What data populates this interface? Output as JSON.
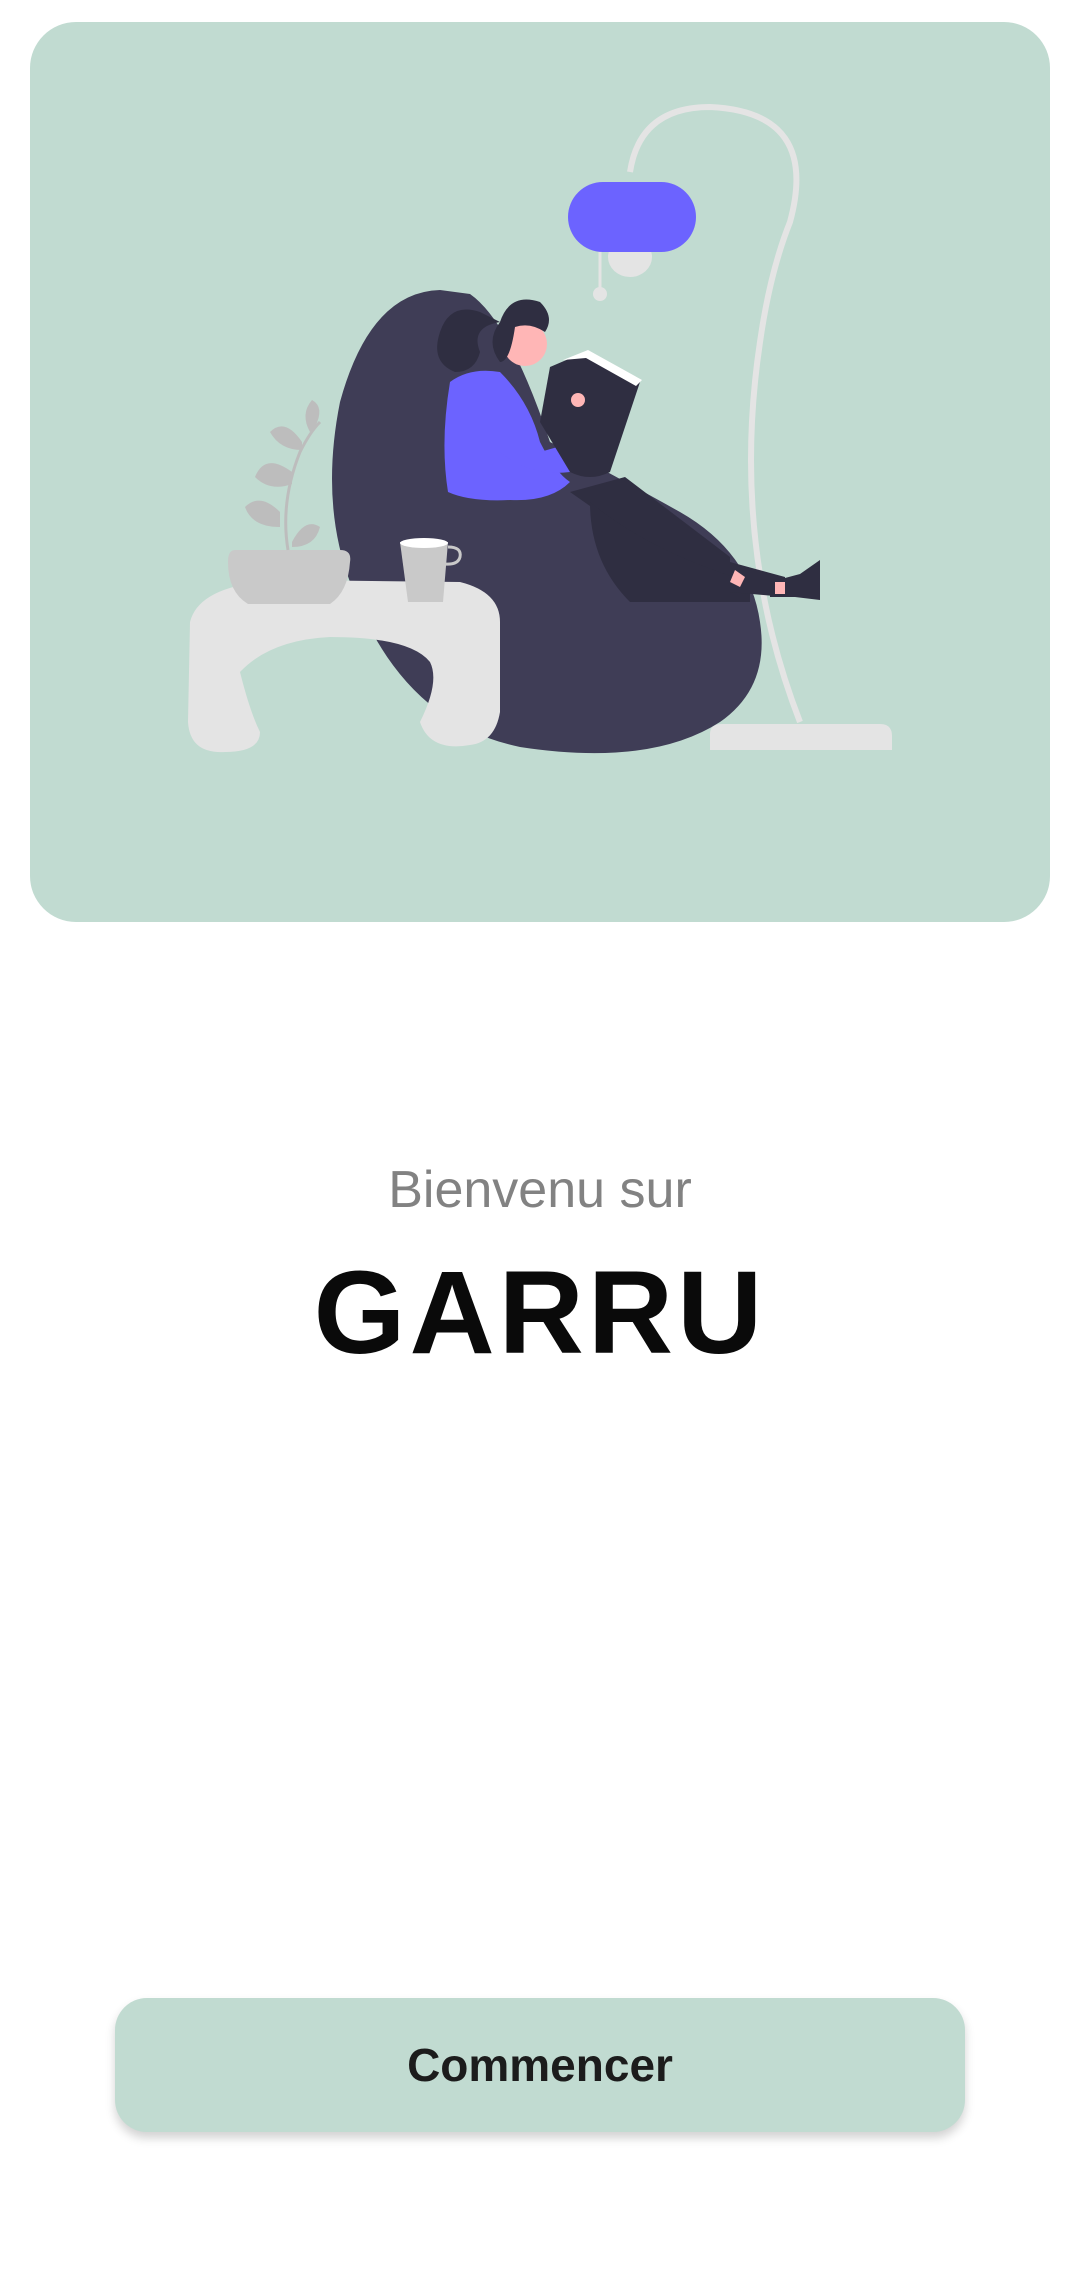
{
  "hero": {
    "illustration": "woman-reading-in-beanbag-illustration",
    "background_color": "#c1dbd1"
  },
  "welcome": {
    "subtitle": "Bienvenu sur",
    "app_name": "GARRU"
  },
  "actions": {
    "start_label": "Commencer"
  },
  "colors": {
    "accent": "#c1dbd1",
    "lamp": "#6c63ff",
    "beanbag": "#3f3d56"
  }
}
